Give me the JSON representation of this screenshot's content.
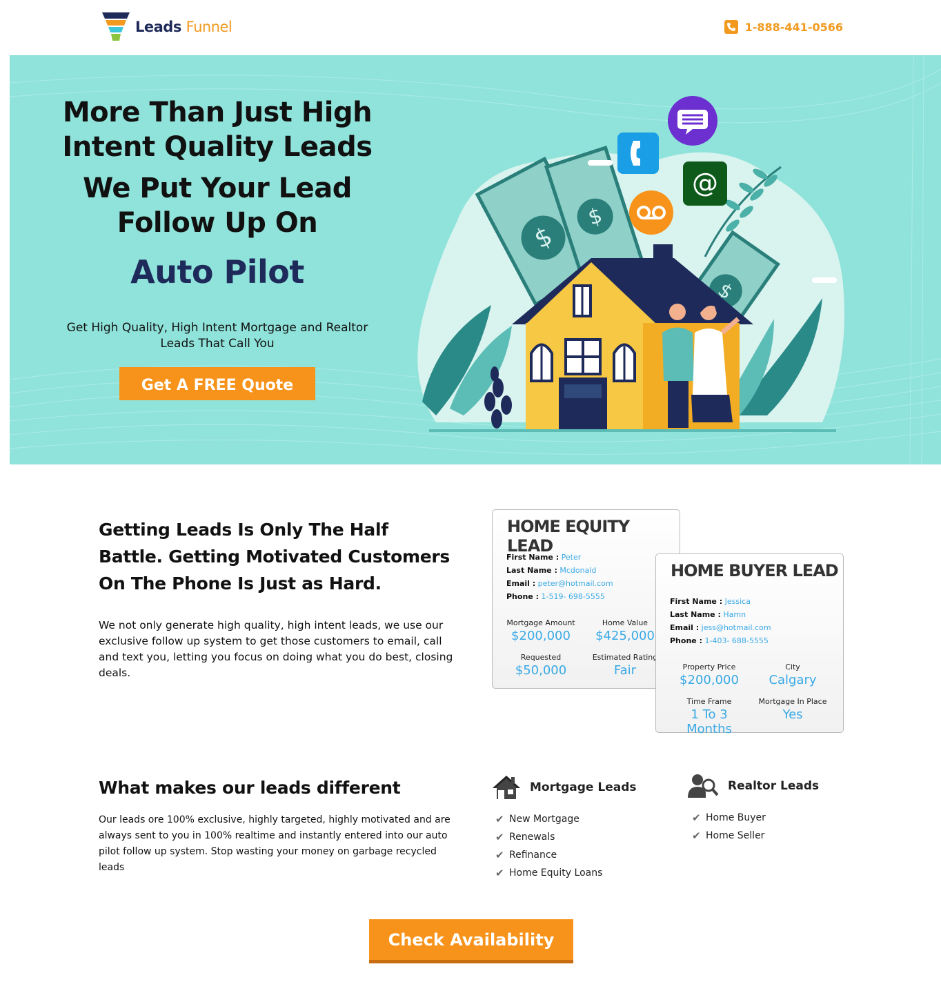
{
  "header": {
    "logo_leads": "Leads",
    "logo_funnel": "Funnel",
    "phone": "1-888-441-0566",
    "phone_icon": "phone-icon"
  },
  "hero": {
    "headline_1": "More Than Just High Intent Quality Leads",
    "headline_2": "We Put Your Lead Follow Up On",
    "headline_3": "Auto Pilot",
    "subtext": "Get High Quality, High Intent Mortgage and Realtor Leads That Call You",
    "cta": "Get A FREE Quote",
    "icons": [
      "phone-icon",
      "chat-icon",
      "at-sign-icon",
      "voicemail-icon"
    ],
    "bg_color": "#8fe3da",
    "accent": "#f7931a",
    "navy": "#1e2a5a"
  },
  "section2": {
    "title": "Getting Leads Is Only The Half Battle. Getting Motivated Customers On The Phone Is Just as Hard.",
    "body": "We not only generate high quality, high intent leads, we use our exclusive follow up system to get those customers to email, call and text you, letting you focus on doing what you do best, closing deals."
  },
  "cards": {
    "equity": {
      "title": "HOME EQUITY LEAD",
      "fields": [
        {
          "k": "First Name :",
          "v": "Peter"
        },
        {
          "k": "Last Name :",
          "v": "Mcdonald"
        },
        {
          "k": "Email :",
          "v": "peter@hotmail.com"
        },
        {
          "k": "Phone :",
          "v": "1-519- 698-5555"
        }
      ],
      "stats": [
        {
          "label": "Mortgage Amount",
          "value": "$200,000"
        },
        {
          "label": "Home Value",
          "value": "$425,000"
        },
        {
          "label": "Requested",
          "value": "$50,000"
        },
        {
          "label": "Estimated Rating",
          "value": "Fair"
        }
      ]
    },
    "buyer": {
      "title": "HOME BUYER LEAD",
      "fields": [
        {
          "k": "First Name :",
          "v": "Jessica"
        },
        {
          "k": "Last Name :",
          "v": "Hamn"
        },
        {
          "k": "Email :",
          "v": "jess@hotmail.com"
        },
        {
          "k": "Phone :",
          "v": "1-403- 688-5555"
        }
      ],
      "stats": [
        {
          "label": "Property Price",
          "value": "$200,000"
        },
        {
          "label": "City",
          "value": "Calgary"
        },
        {
          "label": "Time Frame",
          "value": "1 To 3 Months"
        },
        {
          "label": "Mortgage In Place",
          "value": "Yes"
        }
      ]
    }
  },
  "section3": {
    "title": "What makes our leads different",
    "body": "Our leads ore 100% exclusive, highly targeted, highly motivated and are always sent to you in 100% realtime and instantly entered into our auto pilot follow up system. Stop wasting your money on garbage recycled leads"
  },
  "features": {
    "mortgage": {
      "title": "Mortgage Leads",
      "icon": "house-icon",
      "items": [
        "New Mortgage",
        "Renewals",
        "Refinance",
        "Home Equity Loans"
      ]
    },
    "realtor": {
      "title": "Realtor Leads",
      "icon": "user-search-icon",
      "items": [
        "Home Buyer",
        "Home Seller"
      ]
    }
  },
  "cta": {
    "label": "Check Availability"
  }
}
